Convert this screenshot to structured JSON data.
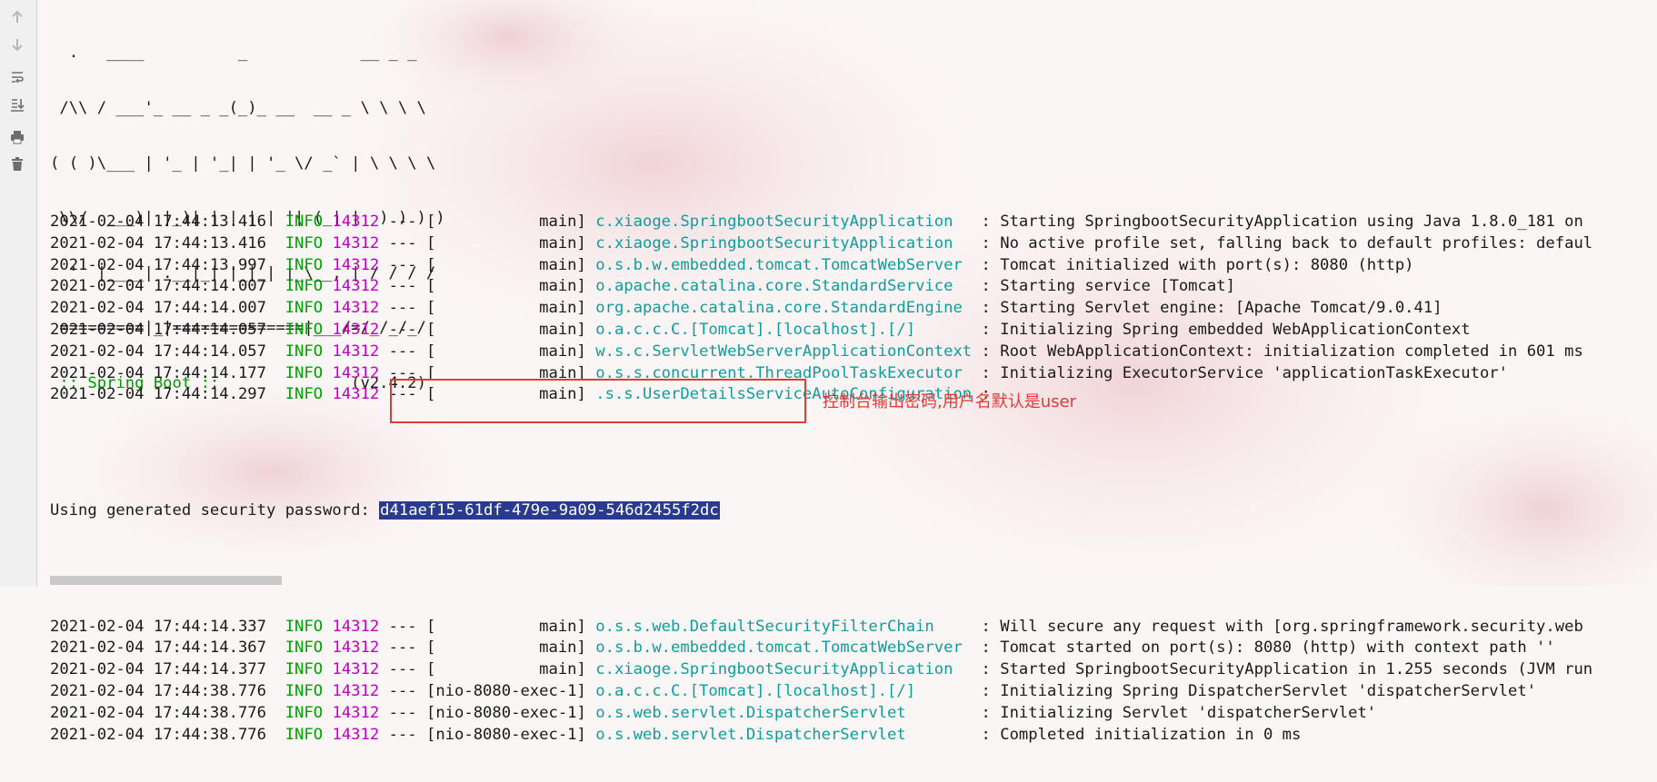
{
  "toolbar": {
    "icons": [
      "arrow-up-icon",
      "arrow-down-icon",
      "soft-wrap-icon",
      "scroll-to-end-icon",
      "print-icon",
      "trash-icon"
    ]
  },
  "banner": {
    "ascii_lines": [
      "  .   ____          _            __ _ _",
      " /\\\\ / ___'_ __ _ _(_)_ __  __ _ \\ \\ \\ \\",
      "( ( )\\___ | '_ | '_| | '_ \\/ _` | \\ \\ \\ \\",
      " \\\\/  ___)| |_)| | | | | || (_| |  ) ) ) )",
      "  '  |____| .__|_| |_|_| |_\\__, | / / / /",
      " =========|_|==============|___/=/_/_/_/"
    ],
    "spring_label": " :: Spring Boot :: ",
    "version": "             (v2.4.2)"
  },
  "logs_before": [
    {
      "timestamp": "2021-02-04 17:44:13.416",
      "level": "INFO",
      "pid": "14312",
      "thread": "[           main]",
      "logger": "c.xiaoge.SpringbootSecurityApplication  ",
      "message": ": Starting SpringbootSecurityApplication using Java 1.8.0_181 on"
    },
    {
      "timestamp": "2021-02-04 17:44:13.416",
      "level": "INFO",
      "pid": "14312",
      "thread": "[           main]",
      "logger": "c.xiaoge.SpringbootSecurityApplication  ",
      "message": ": No active profile set, falling back to default profiles: defaul"
    },
    {
      "timestamp": "2021-02-04 17:44:13.997",
      "level": "INFO",
      "pid": "14312",
      "thread": "[           main]",
      "logger": "o.s.b.w.embedded.tomcat.TomcatWebServer ",
      "message": ": Tomcat initialized with port(s): 8080 (http)"
    },
    {
      "timestamp": "2021-02-04 17:44:14.007",
      "level": "INFO",
      "pid": "14312",
      "thread": "[           main]",
      "logger": "o.apache.catalina.core.StandardService  ",
      "message": ": Starting service [Tomcat]"
    },
    {
      "timestamp": "2021-02-04 17:44:14.007",
      "level": "INFO",
      "pid": "14312",
      "thread": "[           main]",
      "logger": "org.apache.catalina.core.StandardEngine ",
      "message": ": Starting Servlet engine: [Apache Tomcat/9.0.41]"
    },
    {
      "timestamp": "2021-02-04 17:44:14.057",
      "level": "INFO",
      "pid": "14312",
      "thread": "[           main]",
      "logger": "o.a.c.c.C.[Tomcat].[localhost].[/]      ",
      "message": ": Initializing Spring embedded WebApplicationContext"
    },
    {
      "timestamp": "2021-02-04 17:44:14.057",
      "level": "INFO",
      "pid": "14312",
      "thread": "[           main]",
      "logger": "w.s.c.ServletWebServerApplicationContext",
      "message": ": Root WebApplicationContext: initialization completed in 601 ms"
    },
    {
      "timestamp": "2021-02-04 17:44:14.177",
      "level": "INFO",
      "pid": "14312",
      "thread": "[           main]",
      "logger": "o.s.s.concurrent.ThreadPoolTaskExecutor ",
      "message": ": Initializing ExecutorService 'applicationTaskExecutor'"
    },
    {
      "timestamp": "2021-02-04 17:44:14.297",
      "level": "INFO",
      "pid": "14312",
      "thread": "[           main]",
      "logger": ".s.s.UserDetailsServiceAutoConfiguration",
      "message": ":"
    }
  ],
  "password": {
    "label": "Using generated security password: ",
    "value": "d41aef15-61df-479e-9a09-546d2455f2dc",
    "annotation": "控制台输出密码,用户名默认是user"
  },
  "logs_after": [
    {
      "timestamp": "2021-02-04 17:44:14.337",
      "level": "INFO",
      "pid": "14312",
      "thread": "[           main]",
      "logger": "o.s.s.web.DefaultSecurityFilterChain    ",
      "message": ": Will secure any request with [org.springframework.security.web"
    },
    {
      "timestamp": "2021-02-04 17:44:14.367",
      "level": "INFO",
      "pid": "14312",
      "thread": "[           main]",
      "logger": "o.s.b.w.embedded.tomcat.TomcatWebServer ",
      "message": ": Tomcat started on port(s): 8080 (http) with context path ''"
    },
    {
      "timestamp": "2021-02-04 17:44:14.377",
      "level": "INFO",
      "pid": "14312",
      "thread": "[           main]",
      "logger": "c.xiaoge.SpringbootSecurityApplication  ",
      "message": ": Started SpringbootSecurityApplication in 1.255 seconds (JVM run"
    },
    {
      "timestamp": "2021-02-04 17:44:38.776",
      "level": "INFO",
      "pid": "14312",
      "thread": "[nio-8080-exec-1]",
      "logger": "o.a.c.c.C.[Tomcat].[localhost].[/]      ",
      "message": ": Initializing Spring DispatcherServlet 'dispatcherServlet'"
    },
    {
      "timestamp": "2021-02-04 17:44:38.776",
      "level": "INFO",
      "pid": "14312",
      "thread": "[nio-8080-exec-1]",
      "logger": "o.s.web.servlet.DispatcherServlet       ",
      "message": ": Initializing Servlet 'dispatcherServlet'"
    },
    {
      "timestamp": "2021-02-04 17:44:38.776",
      "level": "INFO",
      "pid": "14312",
      "thread": "[nio-8080-exec-1]",
      "logger": "o.s.web.servlet.DispatcherServlet       ",
      "message": ": Completed initialization in 0 ms"
    }
  ],
  "colors": {
    "info": "#00a000",
    "pid": "#c000c0",
    "logger": "#0e9d9d",
    "highlight": "#2a3b8f",
    "annotation": "#e53935"
  }
}
